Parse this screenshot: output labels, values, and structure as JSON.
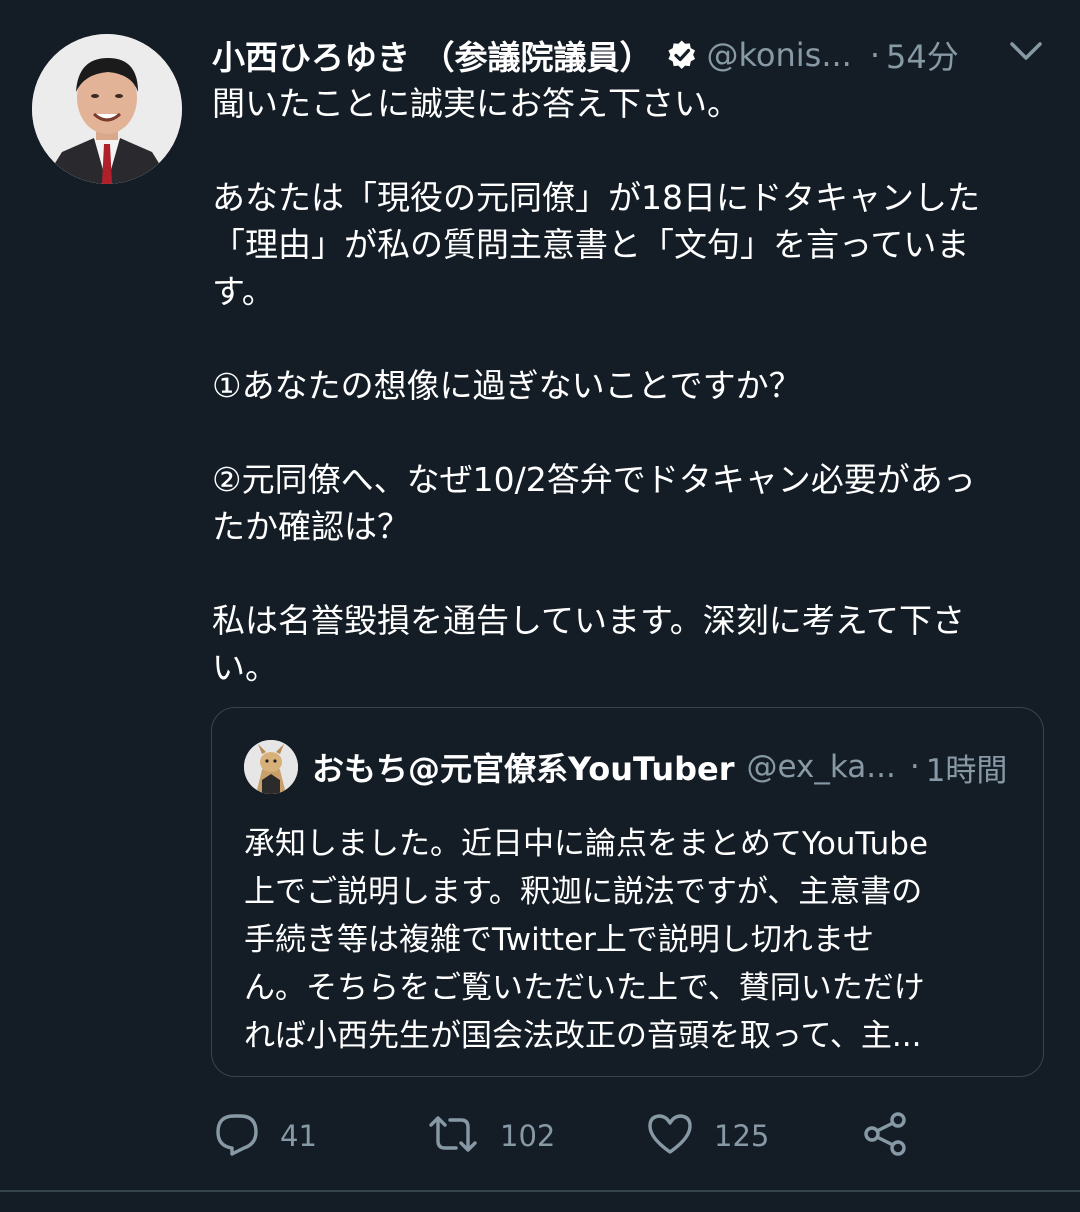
{
  "tweet": {
    "display_name": "小西ひろゆき （参議院議員）",
    "handle": "@konis...",
    "separator": "·",
    "time": "54分",
    "lines": [
      "聞いたことに誠実にお答え下さい。",
      "",
      "あなたは「現役の元同僚」が18日にドタキャンした",
      "「理由」が私の質問主意書と「文句」を言っていま",
      "す。",
      "",
      "①あなたの想像に過ぎないことですか？",
      "",
      "②元同僚へ、なぜ10/2答弁でドタキャン必要があっ",
      "たか確認は？",
      "",
      "私は名誉毀損を通告しています。深刻に考えて下さ",
      "い。"
    ]
  },
  "quote": {
    "display_name": "おもち@元官僚系YouTuber",
    "handle": "@ex_ka...",
    "separator": "·",
    "time": "1時間",
    "lines": [
      "承知しました。近日中に論点をまとめてYouTube",
      "上でご説明します。釈迦に説法ですが、主意書の",
      "手続き等は複雑でTwitter上で説明し切れませ",
      "ん。そちらをご覧いただいた上で、賛同いただけ",
      "れば小西先生が国会法改正の音頭を取って、主..."
    ]
  },
  "actions": {
    "reply_count": "41",
    "retweet_count": "102",
    "like_count": "125"
  },
  "icons": {
    "verified": "verified-badge-icon",
    "caret": "chevron-down-icon",
    "reply": "reply-bubble-icon",
    "retweet": "retweet-icon",
    "like": "heart-icon",
    "share": "share-icon"
  },
  "colors": {
    "background": "#141d26",
    "text": "#ffffff",
    "secondary": "#8899a6",
    "border": "#38444d"
  }
}
